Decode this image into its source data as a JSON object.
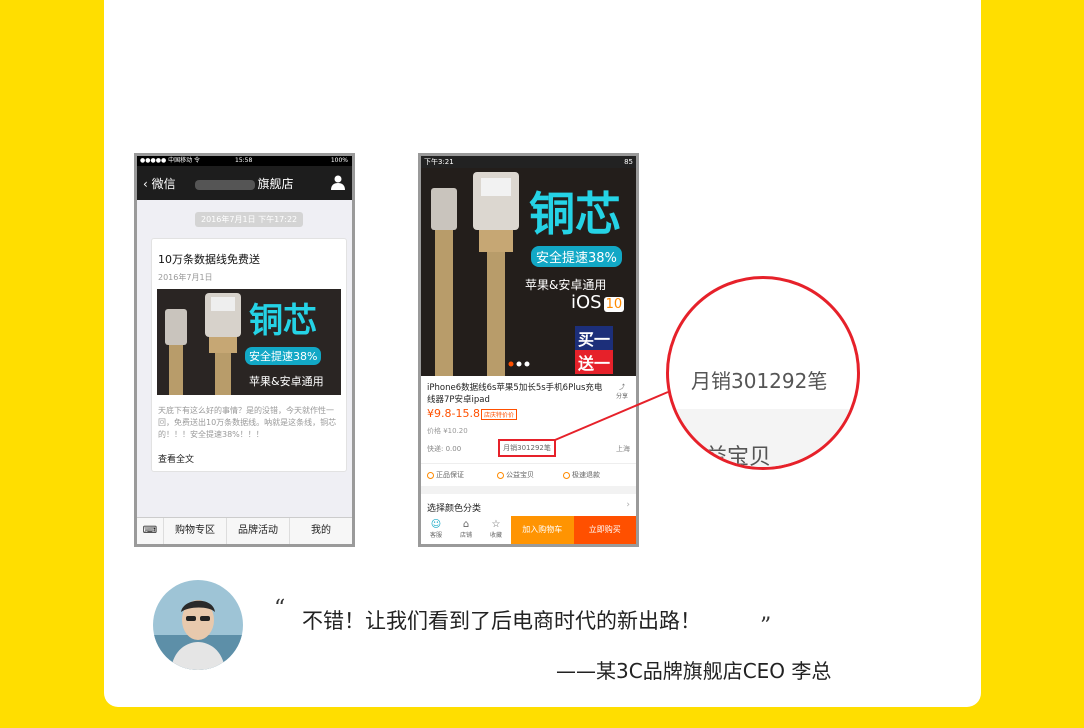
{
  "left_phone": {
    "status": {
      "carrier": "●●●●● 中国移动 令",
      "time": "15:58",
      "battery": "100%"
    },
    "nav": {
      "back": "微信",
      "title_suffix": "旗舰店"
    },
    "timestamp": "2016年7月1日 下午17:22",
    "article": {
      "title": "10万条数据线免费送",
      "date": "2016年7月1日",
      "banner": {
        "main": "铜芯",
        "sub": "安全提速38%",
        "tagline": "苹果&安卓通用"
      },
      "desc": "天底下有这么好的事情？是的没错，今天就作性一回，免费送出10万条数据线。呐就是这条线，铜芯的！！！安全提速38%！！！",
      "read_more": "查看全文"
    },
    "tabs": [
      "购物专区",
      "品牌活动",
      "我的"
    ]
  },
  "right_phone": {
    "status": {
      "time": "下午3:21",
      "battery": "85"
    },
    "hero": {
      "main": "铜芯",
      "sub": "安全提速38%",
      "tagline": "苹果&安卓通用",
      "ios": "iOS",
      "ios_ver": "10",
      "promo1": "买一",
      "promo2": "送一"
    },
    "product": {
      "title": "iPhone6数据线6s苹果5加长5s手机6Plus充电线器7P安卓ipad",
      "share": "分享",
      "price": "¥9.8-15.8",
      "price_tag": "店庆特价价",
      "orig_price": "价格 ¥10.20",
      "shipping": "快递: 0.00",
      "sales": "月销301292笔",
      "location": "上海"
    },
    "guarantees": [
      "正品保证",
      "公益宝贝",
      "极速退款"
    ],
    "sku_label": "选择颜色分类",
    "bottom": {
      "icons": [
        "客服",
        "店铺",
        "收藏"
      ],
      "cart": "加入购物车",
      "buy": "立即购买"
    }
  },
  "magnifier": {
    "text": "月销301292笔",
    "text2": "益宝贝"
  },
  "testimonial": {
    "open": "“",
    "quote": "不错！让我们看到了后电商时代的新出路！",
    "close": "”",
    "author": "——某3C品牌旗舰店CEO 李总"
  },
  "colors": {
    "background": "#ffde00",
    "highlight": "#e6212a",
    "orange": "#ff5000"
  }
}
